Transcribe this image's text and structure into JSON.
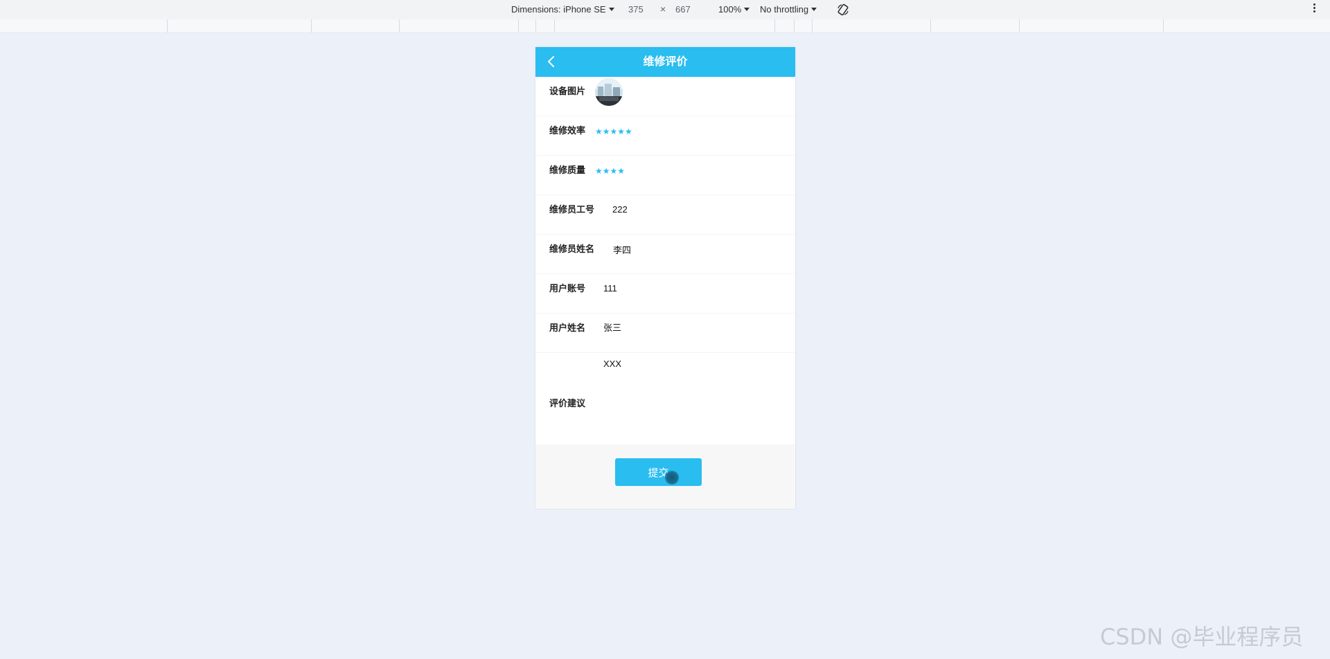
{
  "devtools": {
    "device_label": "Dimensions: iPhone SE",
    "width": "375",
    "times": "×",
    "height": "667",
    "zoom": "100%",
    "throttling": "No throttling"
  },
  "page": {
    "title": "维修评价"
  },
  "form": {
    "device_image_label": "设备图片",
    "efficiency_label": "维修效率",
    "efficiency_stars": "★★★★★",
    "efficiency_rating": 5,
    "quality_label": "维修质量",
    "quality_stars": "★★★★",
    "quality_rating": 4,
    "worker_id_label": "维修员工号",
    "worker_id": "222",
    "worker_name_label": "维修员姓名",
    "worker_name": "李四",
    "user_account_label": "用户账号",
    "user_account": "111",
    "user_name_label": "用户姓名",
    "user_name": "张三",
    "comment_label": "评价建议",
    "comment": "XXX"
  },
  "actions": {
    "submit_label": "提交"
  },
  "colors": {
    "accent": "#29bdf0",
    "background": "#ecf0f9"
  },
  "icons": {
    "back": "chevron-left-icon",
    "rotate": "rotate-icon",
    "menu": "kebab-menu-icon"
  },
  "watermark": "CSDN @毕业程序员"
}
